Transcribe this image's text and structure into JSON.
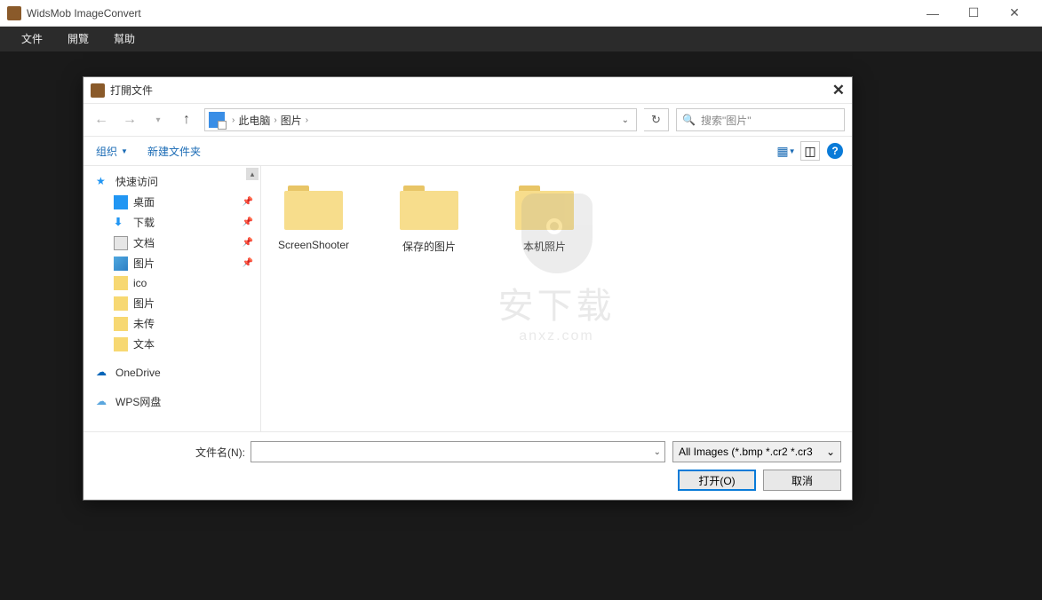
{
  "app": {
    "title": "WidsMob ImageConvert",
    "menus": [
      "文件",
      "開覽",
      "幫助"
    ]
  },
  "dialog": {
    "title": "打開文件",
    "breadcrumb": {
      "loc1": "此电脑",
      "loc2": "图片"
    },
    "search_placeholder": "搜索\"图片\"",
    "toolbar": {
      "organize": "组织",
      "newfolder": "新建文件夹"
    },
    "tree": [
      {
        "label": "快速访问",
        "icon": "star",
        "indent": 0
      },
      {
        "label": "桌面",
        "icon": "desk",
        "indent": 1,
        "pin": true
      },
      {
        "label": "下载",
        "icon": "dl",
        "indent": 1,
        "pin": true
      },
      {
        "label": "文档",
        "icon": "doc",
        "indent": 1,
        "pin": true
      },
      {
        "label": "图片",
        "icon": "pic",
        "indent": 1,
        "pin": true
      },
      {
        "label": "ico",
        "icon": "folder",
        "indent": 1
      },
      {
        "label": "图片",
        "icon": "folder",
        "indent": 1
      },
      {
        "label": "未传",
        "icon": "folder",
        "indent": 1
      },
      {
        "label": "文本",
        "icon": "folder",
        "indent": 1
      },
      {
        "label": "OneDrive",
        "icon": "cloud",
        "indent": 0
      },
      {
        "label": "WPS网盘",
        "icon": "cloud2",
        "indent": 0
      }
    ],
    "files": [
      {
        "name": "ScreenShooter"
      },
      {
        "name": "保存的图片"
      },
      {
        "name": "本机照片"
      }
    ],
    "filename_label": "文件名(N):",
    "filename_value": "",
    "filter": "All Images (*.bmp *.cr2 *.cr3",
    "open_btn": "打开(O)",
    "cancel_btn": "取消"
  },
  "watermark": {
    "line1": "安下载",
    "line2": "anxz.com"
  }
}
